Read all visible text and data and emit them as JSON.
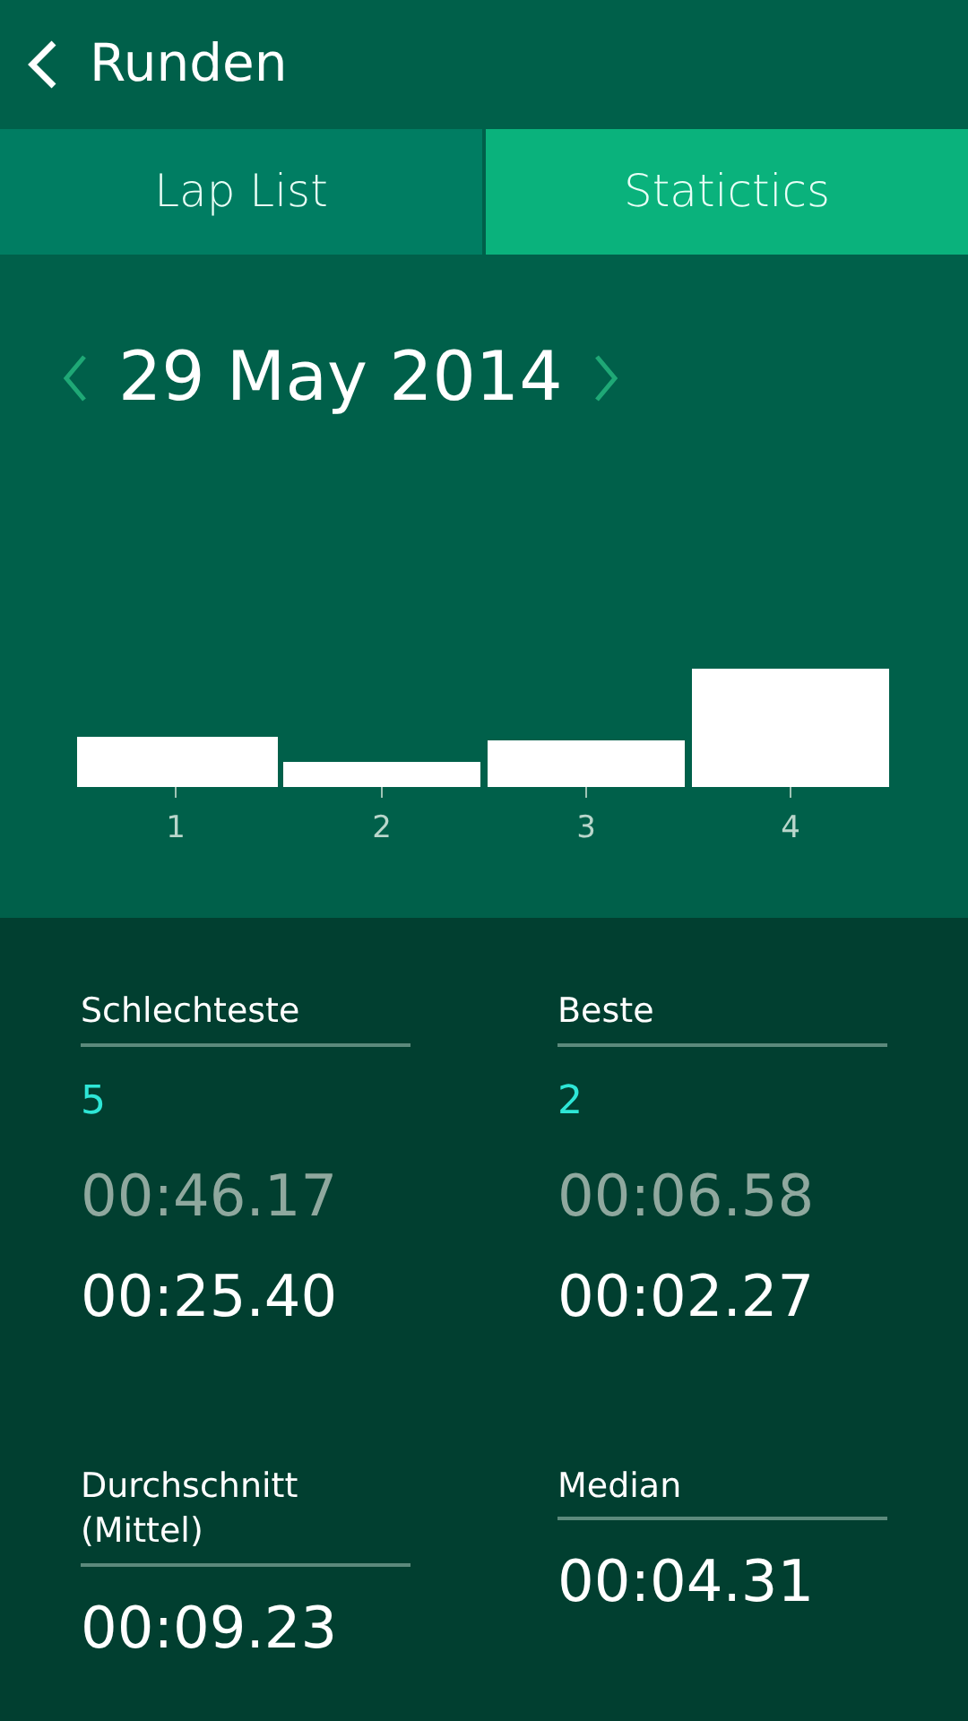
{
  "header": {
    "title": "Runden"
  },
  "tabs": [
    {
      "label": "Lap List",
      "selected": false
    },
    {
      "label": "Statictics",
      "selected": true
    }
  ],
  "date": {
    "text": "29 May 2014"
  },
  "chart": {
    "kind": "picture",
    "bar_labels": [
      "1",
      "2",
      "3",
      "4"
    ]
  },
  "stats": [
    {
      "label": "Schlechteste",
      "lap": "5",
      "lap_time": "00:46.17",
      "time": "00:25.40"
    },
    {
      "label": "Beste",
      "lap": "2",
      "lap_time": "00:06.58",
      "time": "00:02.27"
    },
    {
      "label": "Durchschnitt (Mittel)",
      "time": "00:09.23"
    },
    {
      "label": "Median",
      "time": "00:04.31"
    }
  ]
}
